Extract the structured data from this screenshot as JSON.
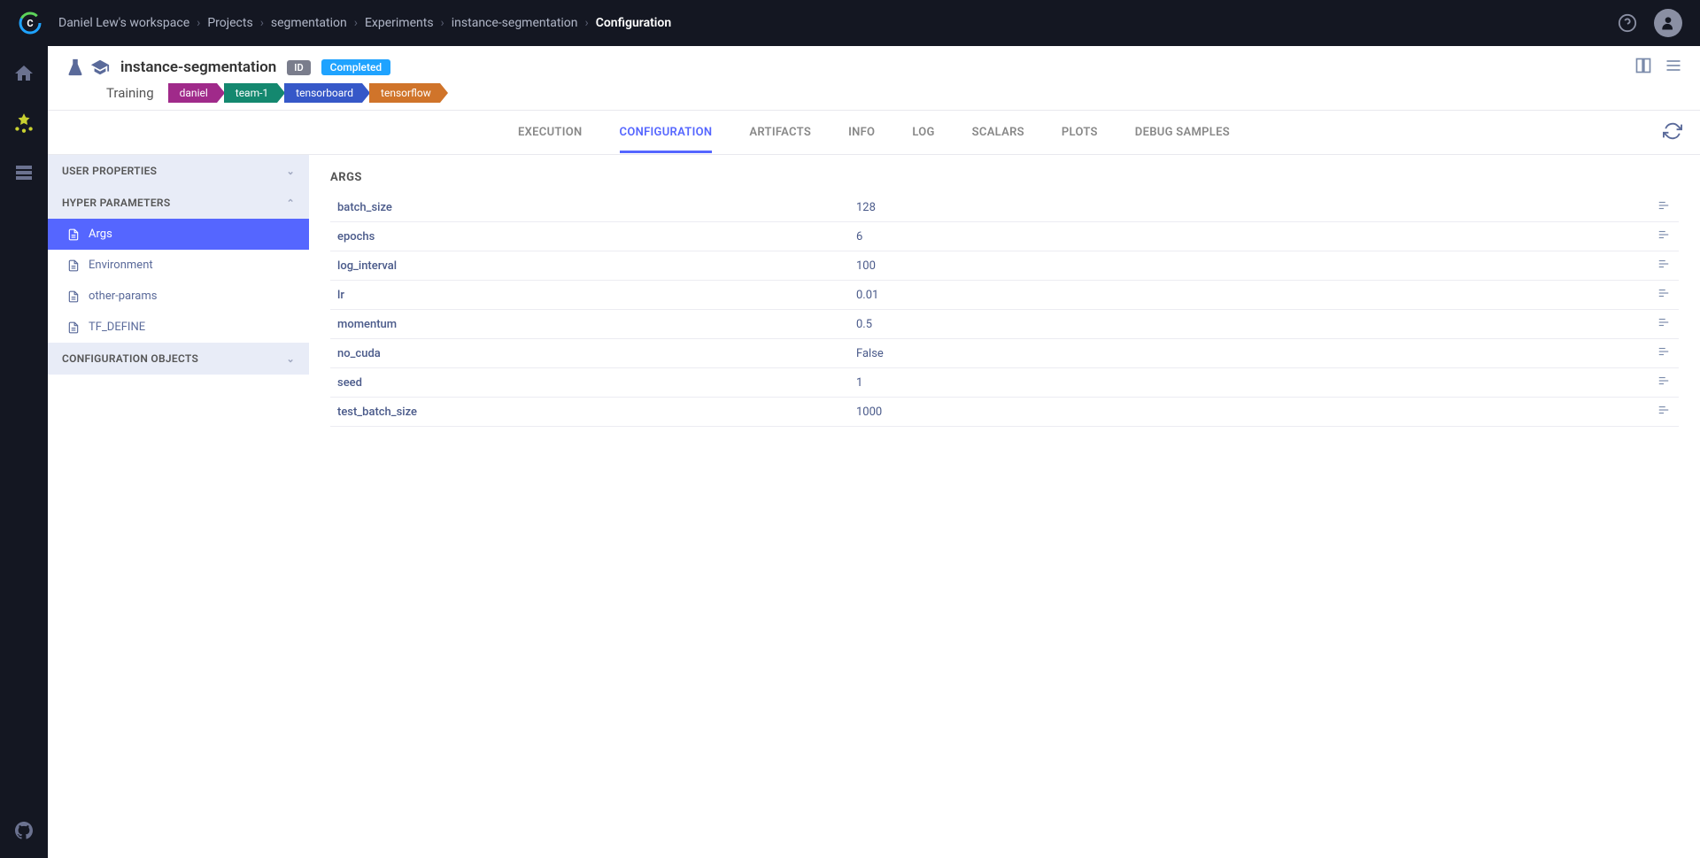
{
  "breadcrumb": {
    "items": [
      "Daniel Lew's workspace",
      "Projects",
      "segmentation",
      "Experiments",
      "instance-segmentation"
    ],
    "current": "Configuration"
  },
  "header": {
    "task_name": "instance-segmentation",
    "id_label": "ID",
    "status": "Completed",
    "type": "Training",
    "tags": [
      {
        "label": "daniel",
        "class": "tag-daniel"
      },
      {
        "label": "team-1",
        "class": "tag-team"
      },
      {
        "label": "tensorboard",
        "class": "tag-tb"
      },
      {
        "label": "tensorflow",
        "class": "tag-tf"
      }
    ]
  },
  "tabs": [
    "EXECUTION",
    "CONFIGURATION",
    "ARTIFACTS",
    "INFO",
    "LOG",
    "SCALARS",
    "PLOTS",
    "DEBUG SAMPLES"
  ],
  "active_tab": "CONFIGURATION",
  "sidebar": {
    "sections": [
      {
        "title": "USER PROPERTIES",
        "expanded": false,
        "items": []
      },
      {
        "title": "HYPER PARAMETERS",
        "expanded": true,
        "items": [
          {
            "label": "Args",
            "active": true
          },
          {
            "label": "Environment",
            "active": false
          },
          {
            "label": "other-params",
            "active": false
          },
          {
            "label": "TF_DEFINE",
            "active": false
          }
        ]
      },
      {
        "title": "CONFIGURATION OBJECTS",
        "expanded": false,
        "items": []
      }
    ]
  },
  "data": {
    "title": "ARGS",
    "params": [
      {
        "name": "batch_size",
        "value": "128"
      },
      {
        "name": "epochs",
        "value": "6"
      },
      {
        "name": "log_interval",
        "value": "100"
      },
      {
        "name": "lr",
        "value": "0.01"
      },
      {
        "name": "momentum",
        "value": "0.5"
      },
      {
        "name": "no_cuda",
        "value": "False"
      },
      {
        "name": "seed",
        "value": "1"
      },
      {
        "name": "test_batch_size",
        "value": "1000"
      }
    ]
  }
}
